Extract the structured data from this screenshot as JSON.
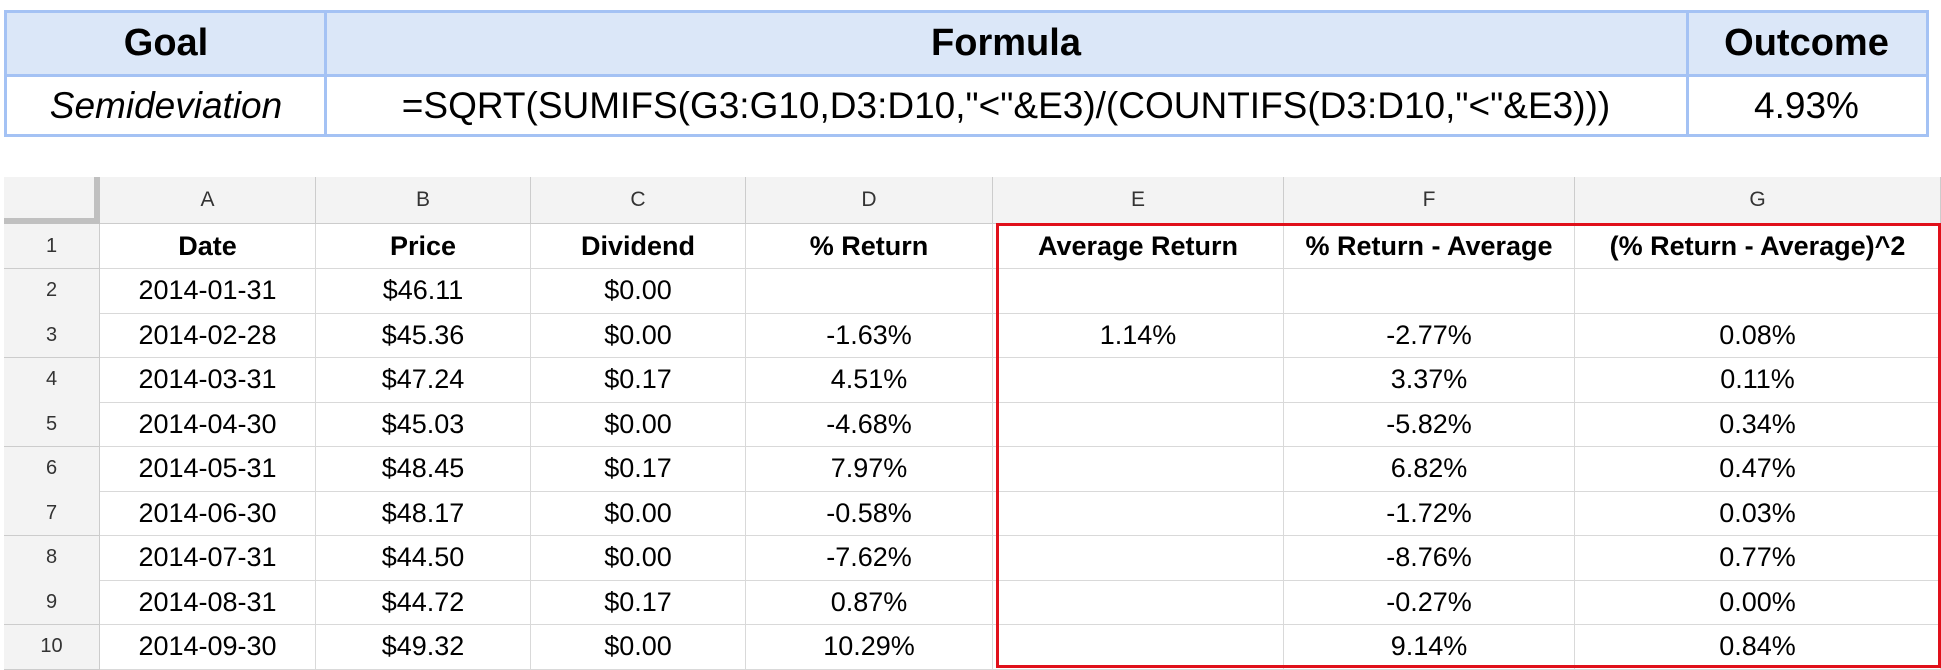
{
  "summary": {
    "headers": {
      "goal": "Goal",
      "formula": "Formula",
      "outcome": "Outcome"
    },
    "values": {
      "goal": "Semideviation",
      "formula": "=SQRT(SUMIFS(G3:G10,D3:D10,\"<\"&E3)/(COUNTIFS(D3:D10,\"<\"&E3)))",
      "outcome": "4.93%"
    }
  },
  "sheet": {
    "columns": [
      "A",
      "B",
      "C",
      "D",
      "E",
      "F",
      "G"
    ],
    "row_numbers": [
      "1",
      "2",
      "3",
      "4",
      "5",
      "6",
      "7",
      "8",
      "9",
      "10"
    ],
    "header_row": [
      "Date",
      "Price",
      "Dividend",
      "% Return",
      "Average Return",
      "% Return - Average",
      "(% Return - Average)^2"
    ],
    "rows": [
      [
        "2014-01-31",
        "$46.11",
        "$0.00",
        "",
        "",
        "",
        ""
      ],
      [
        "2014-02-28",
        "$45.36",
        "$0.00",
        "-1.63%",
        "1.14%",
        "-2.77%",
        "0.08%"
      ],
      [
        "2014-03-31",
        "$47.24",
        "$0.17",
        "4.51%",
        "",
        "3.37%",
        "0.11%"
      ],
      [
        "2014-04-30",
        "$45.03",
        "$0.00",
        "-4.68%",
        "",
        "-5.82%",
        "0.34%"
      ],
      [
        "2014-05-31",
        "$48.45",
        "$0.17",
        "7.97%",
        "",
        "6.82%",
        "0.47%"
      ],
      [
        "2014-06-30",
        "$48.17",
        "$0.00",
        "-0.58%",
        "",
        "-1.72%",
        "0.03%"
      ],
      [
        "2014-07-31",
        "$44.50",
        "$0.00",
        "-7.62%",
        "",
        "-8.76%",
        "0.77%"
      ],
      [
        "2014-08-31",
        "$44.72",
        "$0.17",
        "0.87%",
        "",
        "-0.27%",
        "0.00%"
      ],
      [
        "2014-09-30",
        "$49.32",
        "$0.00",
        "10.29%",
        "",
        "9.14%",
        "0.84%"
      ]
    ],
    "highlight_color": "#e0101a",
    "header_bg": "#f3f3f3",
    "summary_header_bg": "#dbe7f8",
    "summary_border": "#a4c2f4"
  }
}
